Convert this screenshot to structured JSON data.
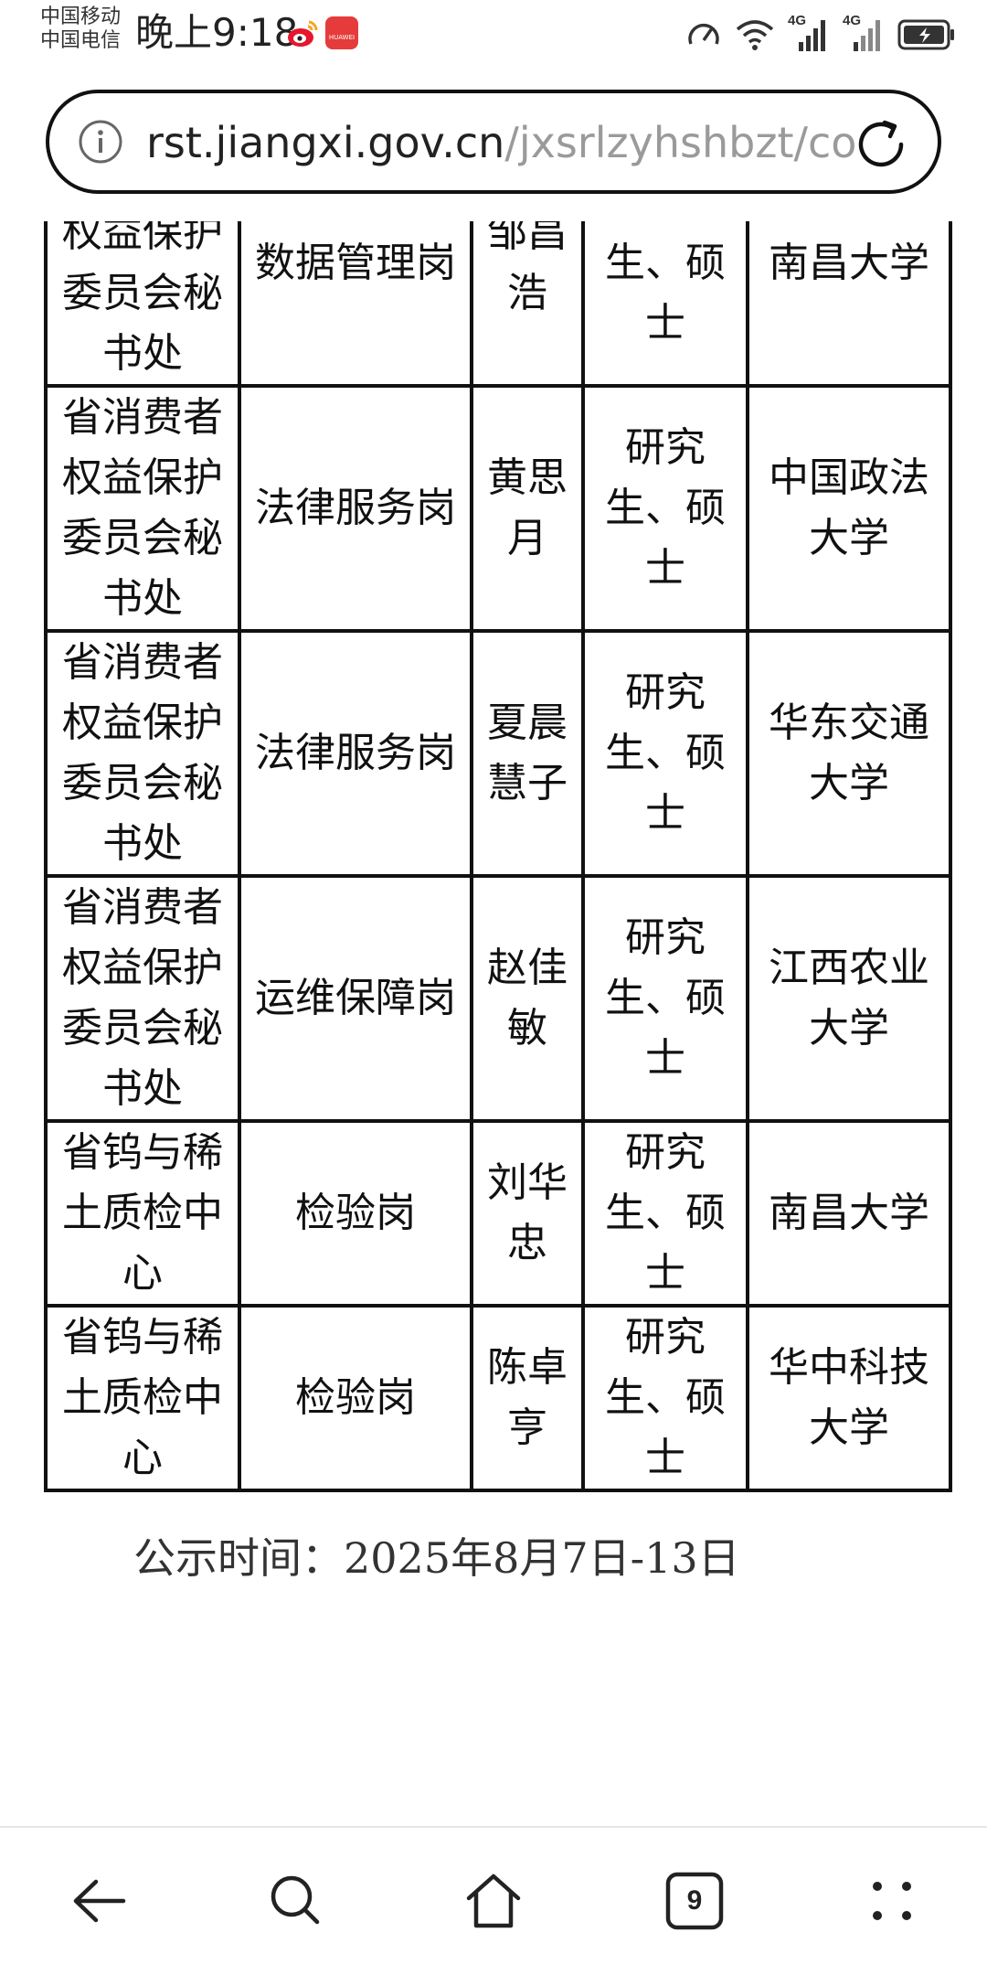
{
  "status_bar": {
    "carrier_1": "中国移动",
    "carrier_2": "中国电信",
    "time": "晚上9:18",
    "network_1": "4G",
    "network_2": "4G"
  },
  "browser": {
    "url_host": "rst.jiangxi.gov.cn",
    "url_path": "/jxsrlzyhshbzt/co"
  },
  "table": {
    "rows": [
      {
        "unit": "省消费者权益保护委员会秘书处",
        "post": "数据管理岗",
        "name": "邹昌浩",
        "degree": "研究生、硕士",
        "school": "南昌大学"
      },
      {
        "unit": "省消费者权益保护委员会秘书处",
        "post": "法律服务岗",
        "name": "黄思月",
        "degree": "研究生、硕士",
        "school": "中国政法大学"
      },
      {
        "unit": "省消费者权益保护委员会秘书处",
        "post": "法律服务岗",
        "name": "夏晨慧子",
        "degree": "研究生、硕士",
        "school": "华东交通大学"
      },
      {
        "unit": "省消费者权益保护委员会秘书处",
        "post": "运维保障岗",
        "name": "赵佳敏",
        "degree": "研究生、硕士",
        "school": "江西农业大学"
      },
      {
        "unit": "省钨与稀土质检中心",
        "post": "检验岗",
        "name": "刘华忠",
        "degree": "研究生、硕士",
        "school": "南昌大学"
      },
      {
        "unit": "省钨与稀土质检中心",
        "post": "检验岗",
        "name": "陈卓亨",
        "degree": "研究生、硕士",
        "school": "华中科技大学"
      }
    ]
  },
  "notice": "公示时间：2025年8月7日-13日",
  "nav": {
    "tab_count": "9"
  },
  "icons": [
    "info-icon",
    "reload-icon",
    "back-icon",
    "search-icon",
    "home-icon",
    "tabs-icon",
    "menu-icon"
  ],
  "colors": {
    "text": "#111111",
    "url_path": "#9a9a9a",
    "weibo": "#e6162d",
    "huawei_badge": "#e53b3b"
  }
}
